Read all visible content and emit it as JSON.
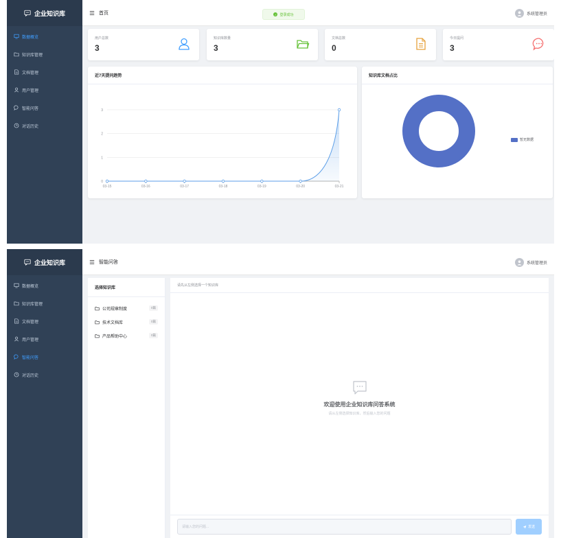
{
  "colors": {
    "sidebar_bg": "#304156",
    "accent": "#409eff",
    "success": "#67c23a",
    "chart_line": "#5b9ee8",
    "donut": "#5470c6"
  },
  "dashboard": {
    "sidebar": {
      "logo": "企业知识库",
      "items": [
        {
          "label": "数据概览",
          "icon": "monitor-icon",
          "active": true
        },
        {
          "label": "知识库管理",
          "icon": "folder-icon",
          "active": false
        },
        {
          "label": "文档管理",
          "icon": "document-icon",
          "active": false
        },
        {
          "label": "用户管理",
          "icon": "user-icon",
          "active": false
        },
        {
          "label": "智能问答",
          "icon": "chat-icon",
          "active": false
        },
        {
          "label": "对话历史",
          "icon": "clock-icon",
          "active": false
        }
      ]
    },
    "header": {
      "title": "首页",
      "user": "系统管理员"
    },
    "toast": "登录成功",
    "stats": [
      {
        "label": "用户总数",
        "value": "3",
        "icon": "user-icon",
        "color": "#409eff"
      },
      {
        "label": "知识库数量",
        "value": "3",
        "icon": "folder-icon",
        "color": "#67c23a"
      },
      {
        "label": "文档总数",
        "value": "0",
        "icon": "document-icon",
        "color": "#e6a23c"
      },
      {
        "label": "今日提问",
        "value": "3",
        "icon": "chat-bubble-icon",
        "color": "#f56c6c"
      }
    ],
    "trend_title": "近7天提问趋势",
    "pie_title": "知识库文档占比"
  },
  "chart_data": [
    {
      "type": "area",
      "x": [
        "03-15",
        "03-16",
        "03-17",
        "03-18",
        "03-19",
        "03-20",
        "03-21"
      ],
      "values": [
        0,
        0,
        0,
        0,
        0,
        0,
        3
      ],
      "y_ticks": [
        "0",
        "1",
        "2",
        "3"
      ],
      "ylim": [
        0,
        3
      ],
      "grid": true
    },
    {
      "type": "pie",
      "donut": true,
      "slices": [
        {
          "name": "暂无数据",
          "value": 1
        }
      ],
      "legend": "right"
    }
  ],
  "qa": {
    "sidebar": {
      "logo": "企业知识库",
      "items": [
        {
          "label": "数据概览",
          "icon": "monitor-icon",
          "active": false
        },
        {
          "label": "知识库管理",
          "icon": "folder-icon",
          "active": false
        },
        {
          "label": "文档管理",
          "icon": "document-icon",
          "active": false
        },
        {
          "label": "用户管理",
          "icon": "user-icon",
          "active": false
        },
        {
          "label": "智能问答",
          "icon": "chat-icon",
          "active": true
        },
        {
          "label": "对话历史",
          "icon": "clock-icon",
          "active": false
        }
      ]
    },
    "header": {
      "title": "智能问答",
      "user": "系统管理员"
    },
    "kb_panel_title": "选择知识库",
    "knowledge_bases": [
      {
        "name": "公司规章制度",
        "count": "0篇"
      },
      {
        "name": "技术文档库",
        "count": "0篇"
      },
      {
        "name": "产品帮助中心",
        "count": "0篇"
      }
    ],
    "chat_hint": "请先从左侧选择一个知识库",
    "welcome_title": "欢迎使用企业知识库问答系统",
    "welcome_sub": "请从左侧选择知识库，然后输入您的问题",
    "input_placeholder": "请输入您的问题...",
    "send_label": "发送"
  }
}
